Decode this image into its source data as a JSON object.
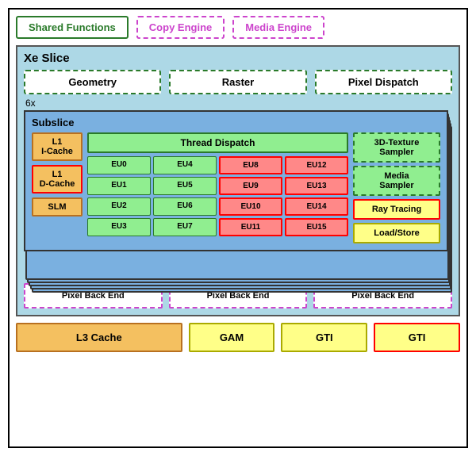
{
  "top": {
    "shared_functions": "Shared Functions",
    "copy_engine": "Copy Engine",
    "media_engine": "Media Engine"
  },
  "xe_slice": {
    "title": "Xe Slice",
    "geometry": "Geometry",
    "raster": "Raster",
    "pixel_dispatch": "Pixel Dispatch",
    "six_label": "6x",
    "subslice": {
      "title": "Subslice",
      "l1_icache": "L1\nI-Cache",
      "l1_dcache": "L1\nD-Cache",
      "slm": "SLM",
      "thread_dispatch": "Thread Dispatch",
      "eu_cells": [
        "EU0",
        "EU4",
        "EU8",
        "EU12",
        "EU1",
        "EU5",
        "EU9",
        "EU13",
        "EU2",
        "EU6",
        "EU10",
        "EU14",
        "EU3",
        "EU7",
        "EU11",
        "EU15"
      ],
      "red_eu_indices": [
        2,
        3,
        6,
        7,
        10,
        11,
        14,
        15
      ],
      "texture_sampler": "3D-Texture\nSampler",
      "media_sampler": "Media\nSampler",
      "ray_tracing": "Ray Tracing",
      "load_store": "Load/Store"
    },
    "pixel_backends": [
      "Pixel Back End",
      "Pixel Back End",
      "Pixel Back End"
    ]
  },
  "bottom": {
    "l3_cache": "L3 Cache",
    "gam": "GAM",
    "gti1": "GTI",
    "gti2": "GTI"
  }
}
